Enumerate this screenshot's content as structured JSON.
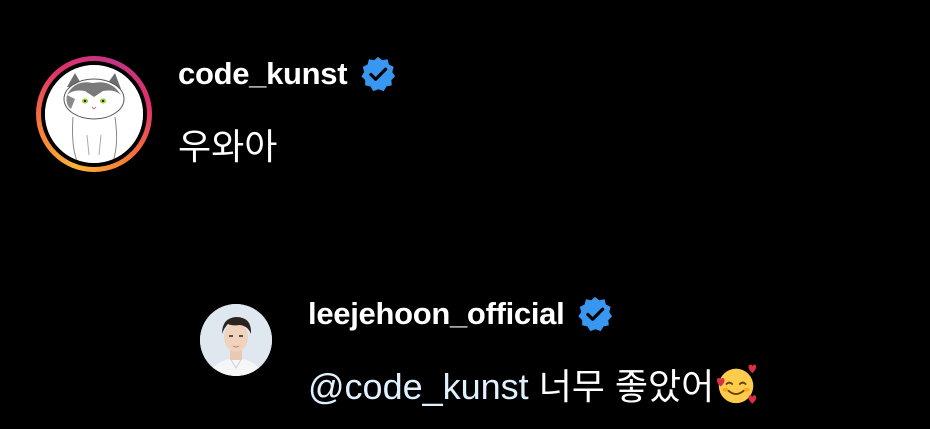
{
  "main_comment": {
    "username": "code_kunst",
    "verified": true,
    "text": "우와아"
  },
  "reply": {
    "username": "leejehoon_official",
    "verified": true,
    "mention": "@code_kunst",
    "text": " 너무 좋았어",
    "emoji": "smiling-face-with-hearts-emoji"
  },
  "colors": {
    "background": "#000000",
    "text": "#ffffff",
    "verified_badge": "#3897f0",
    "mention": "#e0f1ff",
    "story_ring": [
      "#f8b437",
      "#e1306c",
      "#c13584"
    ]
  }
}
